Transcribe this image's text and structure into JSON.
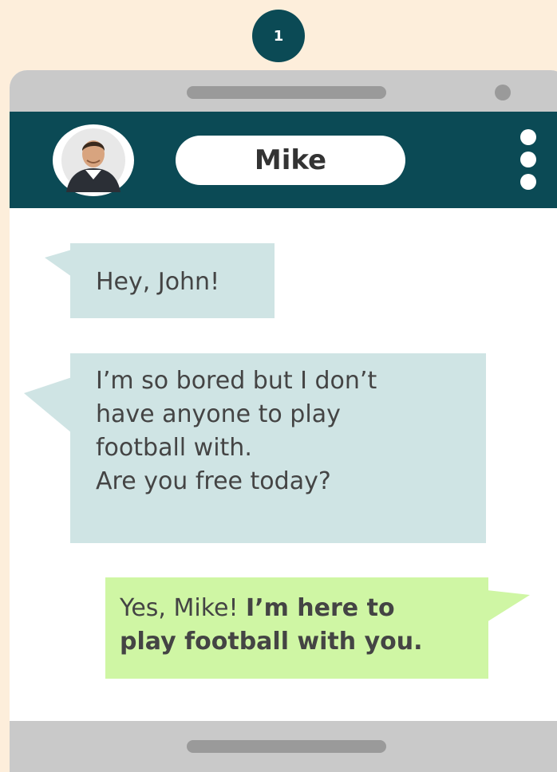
{
  "step": {
    "number": "1"
  },
  "chat": {
    "contact_name": "Mike",
    "avatar_icon": "man-avatar-icon",
    "menu_icon": "vertical-ellipsis-icon"
  },
  "messages": [
    {
      "from": "Mike",
      "text": "Hey, John!"
    },
    {
      "from": "Mike",
      "lines": [
        "I’m so bored but I don’t",
        "have anyone to play",
        "football with.",
        "Are you free today?"
      ]
    },
    {
      "from": "John",
      "prefix": "Yes, Mike! ",
      "bold_line1": "I’m here to",
      "bold_line2": "play football with you."
    }
  ],
  "colors": {
    "background": "#fdeedb",
    "header": "#0b4a55",
    "incoming_bubble": "#cfe4e4",
    "outgoing_bubble": "#cff6a4",
    "phone_frame": "#c9c9c9"
  }
}
